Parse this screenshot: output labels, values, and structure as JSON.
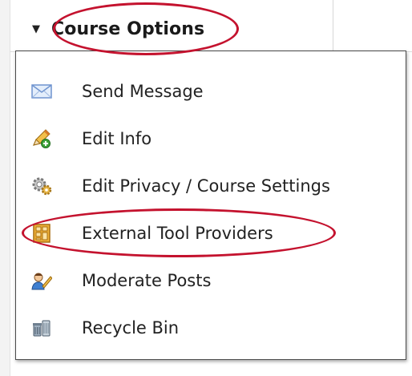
{
  "header": {
    "label": "Course Options",
    "caret_icon": "caret-down-icon"
  },
  "menu": {
    "items": [
      {
        "label": "Send Message",
        "icon": "envelope-icon"
      },
      {
        "label": "Edit Info",
        "icon": "pencil-add-icon"
      },
      {
        "label": "Edit Privacy / Course Settings",
        "icon": "gear-icon"
      },
      {
        "label": "External Tool Providers",
        "icon": "tool-grid-icon"
      },
      {
        "label": "Moderate Posts",
        "icon": "moderator-icon"
      },
      {
        "label": "Recycle Bin",
        "icon": "recycle-bin-icon"
      }
    ]
  },
  "colors": {
    "annotation": "#c4122e",
    "menu_border": "#4a4a4a",
    "text": "#222222"
  }
}
